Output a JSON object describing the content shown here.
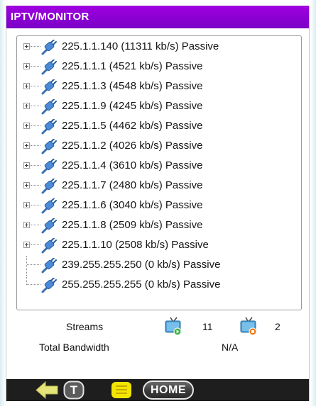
{
  "title": "IPTV/MONITOR",
  "streams": [
    {
      "label": "225.1.1.140 (11311 kb/s) Passive",
      "expandable": true
    },
    {
      "label": "225.1.1.1 (4521 kb/s) Passive",
      "expandable": true
    },
    {
      "label": "225.1.1.3 (4548 kb/s) Passive",
      "expandable": true
    },
    {
      "label": "225.1.1.9 (4245 kb/s) Passive",
      "expandable": true
    },
    {
      "label": "225.1.1.5 (4462 kb/s) Passive",
      "expandable": true
    },
    {
      "label": "225.1.1.2 (4026 kb/s) Passive",
      "expandable": true
    },
    {
      "label": "225.1.1.4 (3610 kb/s) Passive",
      "expandable": true
    },
    {
      "label": "225.1.1.7 (2480 kb/s) Passive",
      "expandable": true
    },
    {
      "label": "225.1.1.6 (3040 kb/s) Passive",
      "expandable": true
    },
    {
      "label": "225.1.1.8 (2509 kb/s) Passive",
      "expandable": true
    },
    {
      "label": "225.1.1.10 (2508 kb/s) Passive",
      "expandable": true
    },
    {
      "label": "239.255.255.250 (0 kb/s) Passive",
      "expandable": false
    },
    {
      "label": "255.255.255.255 (0 kb/s) Passive",
      "expandable": false
    }
  ],
  "stats": {
    "streams_label": "Streams",
    "active_count": "11",
    "inactive_count": "2",
    "bandwidth_label": "Total Bandwidth",
    "bandwidth_value": "N/A"
  },
  "nav": {
    "home_label": "HOME",
    "t_label": "T"
  },
  "colors": {
    "title_bar": "#8a00d4",
    "bottom_bar": "#1e1e1e",
    "back_arrow": "#e6e67a",
    "notes": "#f2e600"
  },
  "icons": {
    "row": "network-plug-icon",
    "active_streams": "tv-play-icon",
    "inactive_streams": "tv-stop-icon",
    "back": "back-arrow-icon",
    "text": "t-button-icon",
    "notes": "notes-icon"
  }
}
